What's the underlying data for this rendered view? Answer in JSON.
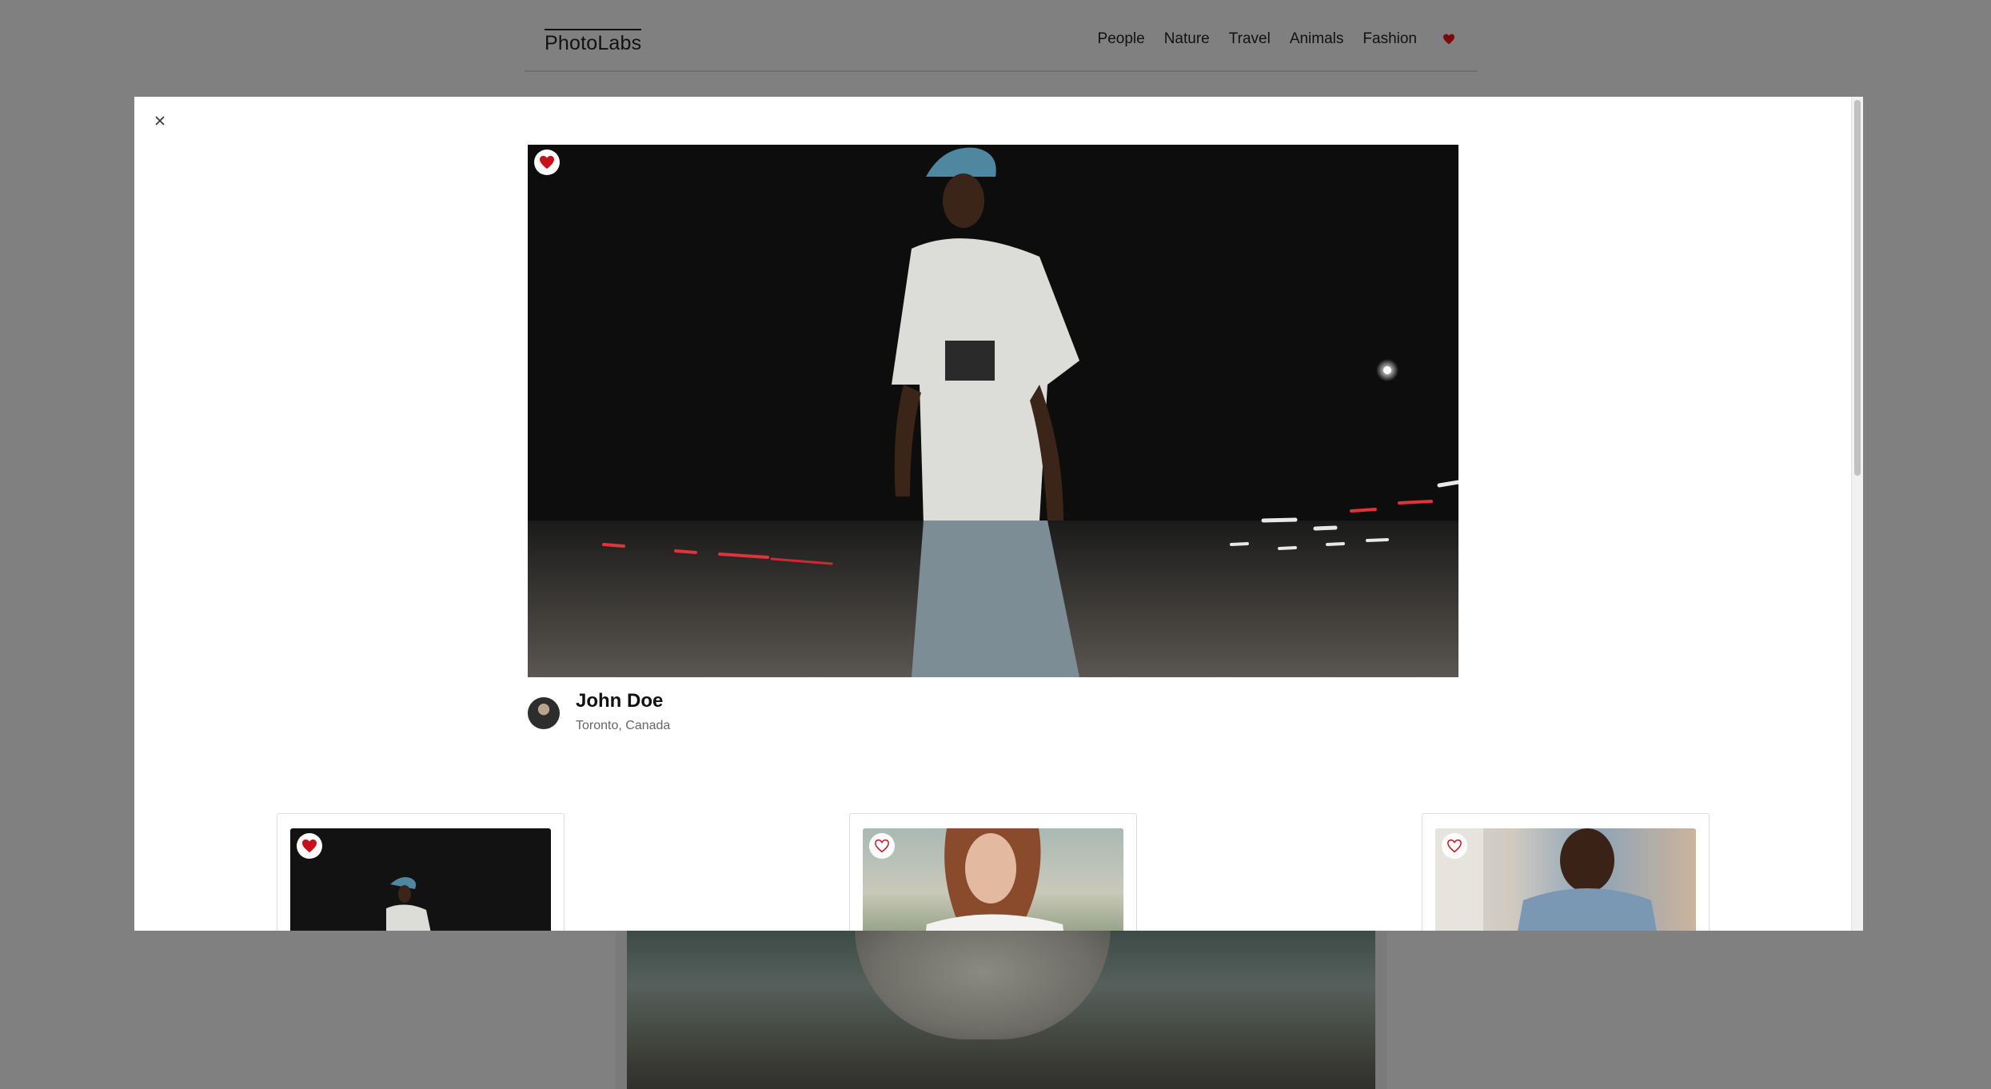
{
  "brand": {
    "logo": "PhotoLabs"
  },
  "nav": {
    "topics": [
      "People",
      "Nature",
      "Travel",
      "Animals",
      "Fashion"
    ],
    "fav_icon": "heart-icon"
  },
  "modal": {
    "close_label": "×",
    "main_photo": {
      "favourited": true,
      "alt": "Man in cap and white t-shirt walking at night"
    },
    "photographer": {
      "name": "John Doe",
      "location": "Toronto, Canada"
    },
    "similar_photos": [
      {
        "favourited": true
      },
      {
        "favourited": false
      },
      {
        "favourited": false
      }
    ]
  },
  "colors": {
    "fav_red": "#c8101a",
    "overlay_gray": "#808080",
    "modal_bg": "#ffffff"
  }
}
